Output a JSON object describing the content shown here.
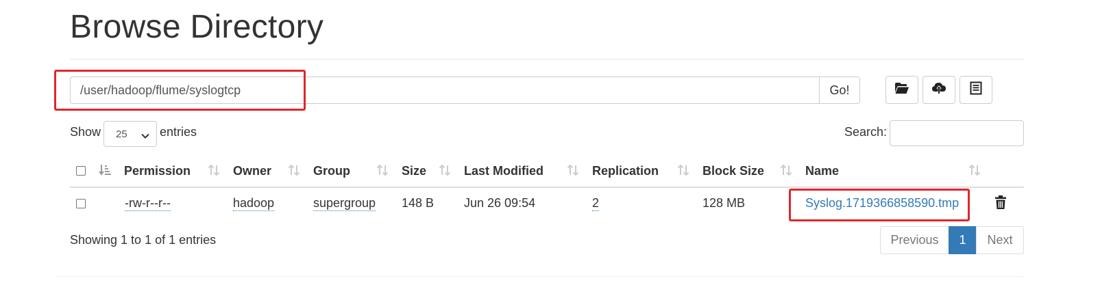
{
  "page": {
    "title": "Browse Directory"
  },
  "path_bar": {
    "value": "/user/hadoop/flume/syslogtcp",
    "go_label": "Go!"
  },
  "toolbar": {
    "icons": [
      "folder-open-icon",
      "cloud-upload-icon",
      "list-icon"
    ]
  },
  "table_controls": {
    "show_label": "Show",
    "page_length": "25",
    "entries_label": "entries",
    "search_label": "Search:",
    "search_value": ""
  },
  "table": {
    "columns": [
      "Permission",
      "Owner",
      "Group",
      "Size",
      "Last Modified",
      "Replication",
      "Block Size",
      "Name"
    ],
    "rows": [
      {
        "permission": "-rw-r--r--",
        "owner": "hadoop",
        "group": "supergroup",
        "size": "148 B",
        "last_modified": "Jun 26 09:54",
        "replication": "2",
        "block_size": "128 MB",
        "name": "Syslog.1719366858590.tmp"
      }
    ]
  },
  "footer": {
    "info": "Showing 1 to 1 of 1 entries",
    "previous": "Previous",
    "current_page": "1",
    "next": "Next"
  },
  "colors": {
    "link": "#337ab7",
    "highlight": "#e0262b",
    "active_page": "#337ab7"
  }
}
